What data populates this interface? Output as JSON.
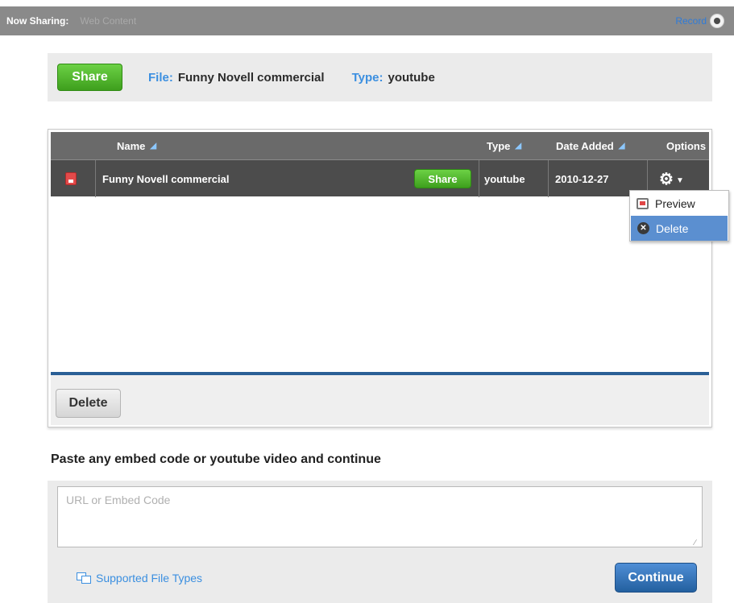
{
  "topbar": {
    "now_sharing_label": "Now Sharing:",
    "now_sharing_value": "Web Content",
    "record_label": "Record"
  },
  "share_panel": {
    "share_button": "Share",
    "file_label": "File:",
    "file_value": "Funny Novell commercial",
    "type_label": "Type:",
    "type_value": "youtube"
  },
  "table": {
    "columns": {
      "name": "Name",
      "type": "Type",
      "date_added": "Date Added",
      "options": "Options"
    },
    "rows": [
      {
        "name": "Funny Novell commercial",
        "share_button": "Share",
        "type": "youtube",
        "date_added": "2010-12-27"
      }
    ],
    "delete_button": "Delete"
  },
  "options_menu": {
    "items": [
      {
        "label": "Preview",
        "icon": "preview-icon"
      },
      {
        "label": "Delete",
        "icon": "delete-icon"
      }
    ]
  },
  "embed": {
    "title": "Paste any embed code or youtube video and continue",
    "placeholder": "URL or Embed Code",
    "value": "",
    "supported_link": "Supported File Types",
    "continue_button": "Continue"
  },
  "colors": {
    "accent_blue": "#3b8fe0",
    "share_green": "#4db52a",
    "header_grey": "#6a6a6a",
    "row_grey": "#4c4c4c",
    "menu_highlight": "#5b8fd0"
  }
}
